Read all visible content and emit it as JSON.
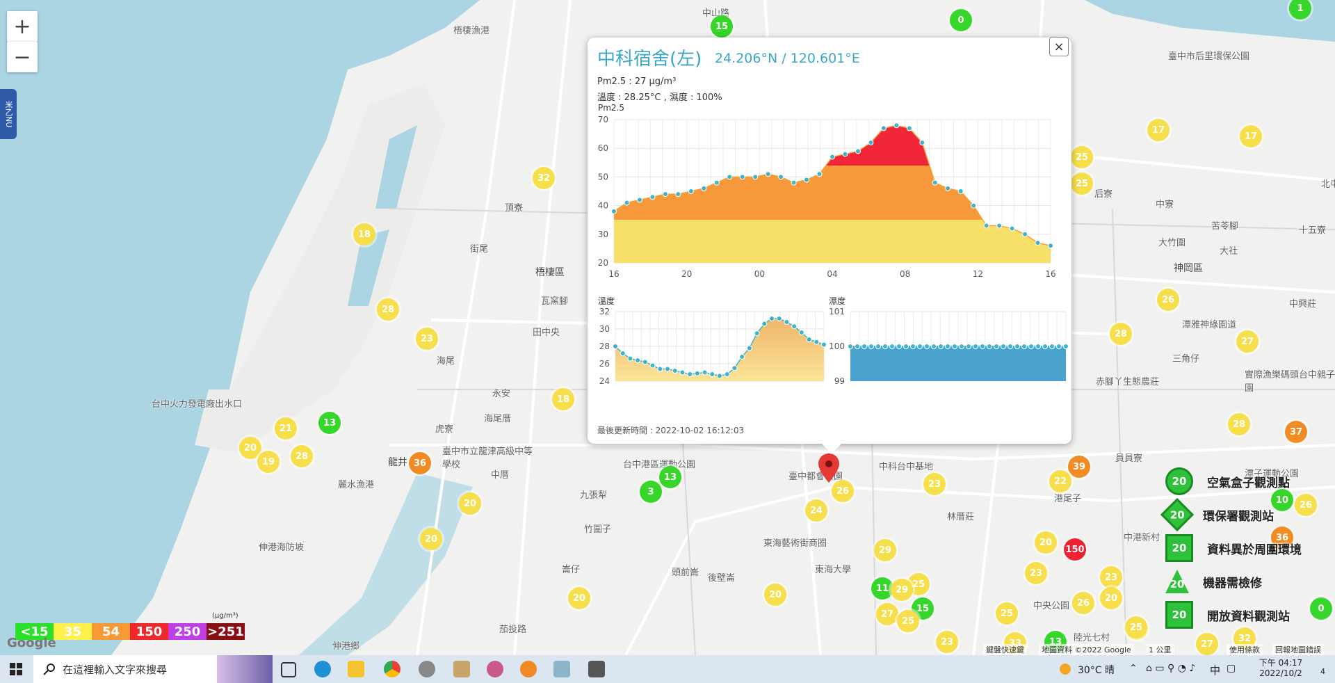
{
  "map": {
    "places": [
      {
        "t": "梧棲漁港"
      },
      {
        "t": "中山路"
      },
      {
        "t": "臺中市后里環保公園"
      },
      {
        "t": "頂寮"
      },
      {
        "t": "街尾"
      },
      {
        "t": "梧棲區"
      },
      {
        "t": "瓦窯腳"
      },
      {
        "t": "田中央"
      },
      {
        "t": "海尾"
      },
      {
        "t": "永安"
      },
      {
        "t": "海尾厝"
      },
      {
        "t": "台中火力發電廠出水口"
      },
      {
        "t": "虎寮"
      },
      {
        "t": "龍井"
      },
      {
        "t": "臺中市立龍津高級中等學校"
      },
      {
        "t": "中厝"
      },
      {
        "t": "台中港區運動公園"
      },
      {
        "t": "九張犁"
      },
      {
        "t": "竹圍子"
      },
      {
        "t": "麗水漁港"
      },
      {
        "t": "伸港海防坡"
      },
      {
        "t": "崙仔"
      },
      {
        "t": "頭前崙"
      },
      {
        "t": "後壁崙"
      },
      {
        "t": "東海藝術街商圈"
      },
      {
        "t": "東海大學"
      },
      {
        "t": "伸港鄉"
      },
      {
        "t": "茄投路"
      },
      {
        "t": "中科台中基地"
      },
      {
        "t": "林厝莊"
      },
      {
        "t": "港尾子"
      },
      {
        "t": "員員寮"
      },
      {
        "t": "中寮"
      },
      {
        "t": "大竹圍"
      },
      {
        "t": "苦苓腳"
      },
      {
        "t": "大社"
      },
      {
        "t": "神岡區"
      },
      {
        "t": "中興莊"
      },
      {
        "t": "三角仔"
      },
      {
        "t": "潭雅神綠園道"
      },
      {
        "t": "赤腳丫生態農莊"
      },
      {
        "t": "實際漁樂碼頭台中親子園"
      },
      {
        "t": "十五寮"
      },
      {
        "t": "后寮"
      },
      {
        "t": "中央公園"
      },
      {
        "t": "陸光七村"
      },
      {
        "t": "中港新村"
      },
      {
        "t": "北屯"
      },
      {
        "t": "潭子運動公園"
      },
      {
        "t": "臺中都會公園"
      }
    ],
    "markers": [
      {
        "v": "15",
        "c": "green"
      },
      {
        "v": "0",
        "c": "green"
      },
      {
        "v": "1",
        "c": "green"
      },
      {
        "v": "32",
        "c": "yellow"
      },
      {
        "v": "18",
        "c": "yellow"
      },
      {
        "v": "28",
        "c": "yellow"
      },
      {
        "v": "23",
        "c": "yellow"
      },
      {
        "v": "21",
        "c": "yellow"
      },
      {
        "v": "13",
        "c": "green"
      },
      {
        "v": "20",
        "c": "yellow"
      },
      {
        "v": "19",
        "c": "yellow"
      },
      {
        "v": "28",
        "c": "yellow"
      },
      {
        "v": "36",
        "c": "orange"
      },
      {
        "v": "18",
        "c": "yellow"
      },
      {
        "v": "20",
        "c": "yellow"
      },
      {
        "v": "20",
        "c": "yellow"
      },
      {
        "v": "13",
        "c": "green"
      },
      {
        "v": "3",
        "c": "green"
      },
      {
        "v": "20",
        "c": "yellow"
      },
      {
        "v": "24",
        "c": "yellow"
      },
      {
        "v": "26",
        "c": "yellow"
      },
      {
        "v": "29",
        "c": "yellow"
      },
      {
        "v": "20",
        "c": "yellow"
      },
      {
        "v": "11",
        "c": "green"
      },
      {
        "v": "25",
        "c": "yellow"
      },
      {
        "v": "29",
        "c": "yellow"
      },
      {
        "v": "27",
        "c": "yellow"
      },
      {
        "v": "15",
        "c": "green"
      },
      {
        "v": "25",
        "c": "yellow"
      },
      {
        "v": "23",
        "c": "yellow"
      },
      {
        "v": "17",
        "c": "yellow"
      },
      {
        "v": "17",
        "c": "yellow"
      },
      {
        "v": "25",
        "c": "yellow"
      },
      {
        "v": "25",
        "c": "yellow"
      },
      {
        "v": "26",
        "c": "yellow"
      },
      {
        "v": "28",
        "c": "yellow"
      },
      {
        "v": "27",
        "c": "yellow"
      },
      {
        "v": "28",
        "c": "yellow"
      },
      {
        "v": "37",
        "c": "orange"
      },
      {
        "v": "39",
        "c": "orange"
      },
      {
        "v": "22",
        "c": "yellow"
      },
      {
        "v": "20",
        "c": "yellow"
      },
      {
        "v": "150",
        "c": "red"
      },
      {
        "v": "23",
        "c": "yellow"
      },
      {
        "v": "23",
        "c": "yellow"
      },
      {
        "v": "25",
        "c": "yellow"
      },
      {
        "v": "26",
        "c": "yellow"
      },
      {
        "v": "20",
        "c": "yellow"
      },
      {
        "v": "24",
        "c": "yellow"
      },
      {
        "v": "10",
        "c": "green"
      },
      {
        "v": "26",
        "c": "yellow"
      },
      {
        "v": "36",
        "c": "orange"
      },
      {
        "v": "0",
        "c": "green"
      },
      {
        "v": "23",
        "c": "yellow"
      },
      {
        "v": "33",
        "c": "yellow"
      },
      {
        "v": "13",
        "c": "green"
      },
      {
        "v": "25",
        "c": "yellow"
      },
      {
        "v": "32",
        "c": "yellow"
      },
      {
        "v": "27",
        "c": "yellow"
      }
    ],
    "zoom_in": "+",
    "zoom_out": "−",
    "side_tab": "米乙NU"
  },
  "popup": {
    "title": "中科宿舍(左)",
    "coord": "24.206°N / 120.601°E",
    "pm_line": "Pm2.5 : 27 μg/m³",
    "env_line": "溫度 : 28.25°C , 濕度 : 100%",
    "updated": "最後更新時間 : 2022-10-02 16:12:03",
    "close": "×"
  },
  "chart_data": [
    {
      "type": "area",
      "title": "Pm2.5",
      "ylim": [
        20,
        70
      ],
      "yticks": [
        20,
        30,
        40,
        50,
        60,
        70
      ],
      "xticks": [
        "16",
        "20",
        "00",
        "04",
        "08",
        "12",
        "16"
      ],
      "values": [
        38,
        41,
        42,
        43,
        44,
        44,
        45,
        46,
        48,
        50,
        50,
        50,
        51,
        50,
        48,
        49,
        51,
        57,
        58,
        59,
        62,
        67,
        68,
        67,
        62,
        48,
        46,
        45,
        40,
        33,
        33,
        32,
        30,
        27,
        26
      ],
      "color_bands": [
        {
          "max": 35,
          "color": "#f7e06a"
        },
        {
          "max": 54,
          "color": "#f7993a"
        },
        {
          "max": 150,
          "color": "#f2263a"
        }
      ]
    },
    {
      "type": "area",
      "title": "溫度",
      "ylim": [
        24,
        32
      ],
      "yticks": [
        24,
        26,
        28,
        30,
        32
      ],
      "values": [
        28,
        27.2,
        26.6,
        26.4,
        26.2,
        25.8,
        25.4,
        25.4,
        25.2,
        25.0,
        24.8,
        24.9,
        25.0,
        24.8,
        24.6,
        24.8,
        25.5,
        26.8,
        27.8,
        29.5,
        30.6,
        31.2,
        31.2,
        30.8,
        30.3,
        29.6,
        28.8,
        28.5,
        28.2
      ],
      "color": "#f1c987"
    },
    {
      "type": "area",
      "title": "濕度",
      "ylim": [
        99,
        101
      ],
      "yticks": [
        99,
        100,
        101
      ],
      "values": [
        100,
        100,
        100,
        100,
        100,
        100,
        100,
        100,
        100,
        100,
        100,
        100,
        100,
        100,
        100,
        100,
        100,
        100,
        100,
        100,
        100,
        100,
        100,
        100,
        100,
        100,
        100,
        100,
        100,
        100,
        100,
        100
      ],
      "color": "#4aa3cc"
    }
  ],
  "aq_legend": {
    "items": [
      {
        "t": "<15",
        "c": "#2be02b"
      },
      {
        "t": "35",
        "c": "#fdf14a"
      },
      {
        "t": "54",
        "c": "#f79a35"
      },
      {
        "t": "150",
        "c": "#f1272b"
      },
      {
        "t": "250",
        "c": "#bf3fe6"
      },
      {
        "t": ">251",
        "c": "#8a0f15"
      }
    ],
    "unit": "(μg/m³)"
  },
  "station_legend": [
    {
      "t": "空氣盒子觀測點",
      "v": "20",
      "shape": "circle"
    },
    {
      "t": "環保署觀測站",
      "v": "20",
      "shape": "diamond"
    },
    {
      "t": "資料異於周圍環境",
      "v": "20",
      "shape": "square"
    },
    {
      "t": "機器需檢修",
      "v": "20",
      "shape": "triangle"
    },
    {
      "t": "開放資料觀測站",
      "v": "20",
      "shape": "square"
    }
  ],
  "attribution": {
    "google": "Google",
    "shortcuts": "鍵盤快速鍵",
    "mapdata": "地圖資料 ©2022 Google",
    "scale": "1 公里",
    "terms": "使用條款",
    "report": "回報地圖錯誤"
  },
  "taskbar": {
    "search_placeholder": "在這裡輸入文字來搜尋",
    "weather": "30°C 晴",
    "ime": "中",
    "time": "下午 04:17",
    "date": "2022/10/2",
    "notif": "4"
  }
}
